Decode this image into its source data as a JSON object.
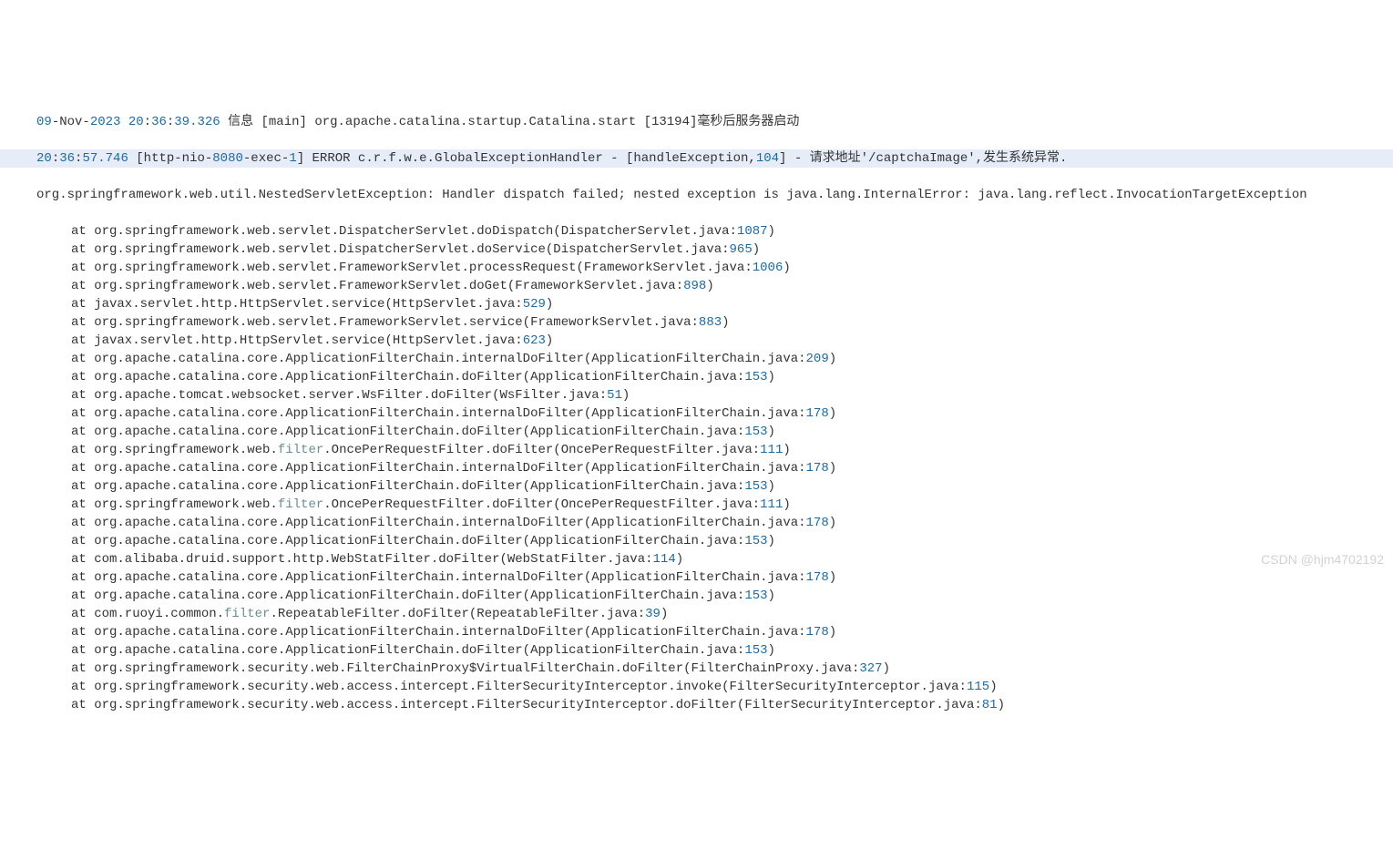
{
  "line1": {
    "day": "09",
    "dash1": "-Nov-",
    "year": "2023",
    "sp1": " ",
    "h": "20",
    "c1": ":",
    "m": "36",
    "c2": ":",
    "s": "39.326",
    "rest": " 信息 [main] org.apache.catalina.startup.Catalina.start [13194]毫秒后服务器启动"
  },
  "line2": {
    "h": "20",
    "c1": ":",
    "m": "36",
    "c2": ":",
    "s": "57.746",
    "thread1": " [http-nio-",
    "port": "8080",
    "thread2": "-exec-",
    "execno": "1",
    "thread3": "] ERROR c.r.f.w.e.GlobalExceptionHandler - [handleException,",
    "lineNo": "104",
    "thread4": "] - 请求地址'/captchaImage',发生系统异常."
  },
  "excMsg": "org.springframework.web.util.NestedServletException: Handler dispatch failed; nested exception is java.lang.InternalError: java.lang.reflect.InvocationTargetException",
  "stack": [
    {
      "pre": "at org.springframework.web.servlet.DispatcherServlet.doDispatch(DispatcherServlet.java:",
      "num": "1087",
      "post": ")"
    },
    {
      "pre": "at org.springframework.web.servlet.DispatcherServlet.doService(DispatcherServlet.java:",
      "num": "965",
      "post": ")"
    },
    {
      "pre": "at org.springframework.web.servlet.FrameworkServlet.processRequest(FrameworkServlet.java:",
      "num": "1006",
      "post": ")"
    },
    {
      "pre": "at org.springframework.web.servlet.FrameworkServlet.doGet(FrameworkServlet.java:",
      "num": "898",
      "post": ")"
    },
    {
      "pre": "at javax.servlet.http.HttpServlet.service(HttpServlet.java:",
      "num": "529",
      "post": ")"
    },
    {
      "pre": "at org.springframework.web.servlet.FrameworkServlet.service(FrameworkServlet.java:",
      "num": "883",
      "post": ")"
    },
    {
      "pre": "at javax.servlet.http.HttpServlet.service(HttpServlet.java:",
      "num": "623",
      "post": ")"
    },
    {
      "pre": "at org.apache.catalina.core.ApplicationFilterChain.internalDoFilter(ApplicationFilterChain.java:",
      "num": "209",
      "post": ")"
    },
    {
      "pre": "at org.apache.catalina.core.ApplicationFilterChain.doFilter(ApplicationFilterChain.java:",
      "num": "153",
      "post": ")"
    },
    {
      "pre": "at org.apache.tomcat.websocket.server.WsFilter.doFilter(WsFilter.java:",
      "num": "51",
      "post": ")"
    },
    {
      "pre": "at org.apache.catalina.core.ApplicationFilterChain.internalDoFilter(ApplicationFilterChain.java:",
      "num": "178",
      "post": ")"
    },
    {
      "pre": "at org.apache.catalina.core.ApplicationFilterChain.doFilter(ApplicationFilterChain.java:",
      "num": "153",
      "post": ")"
    },
    {
      "pre": "at org.springframework.web.",
      "kw": "filter",
      "mid": ".OncePerRequestFilter.doFilter(OncePerRequestFilter.java:",
      "num": "111",
      "post": ")"
    },
    {
      "pre": "at org.apache.catalina.core.ApplicationFilterChain.internalDoFilter(ApplicationFilterChain.java:",
      "num": "178",
      "post": ")"
    },
    {
      "pre": "at org.apache.catalina.core.ApplicationFilterChain.doFilter(ApplicationFilterChain.java:",
      "num": "153",
      "post": ")"
    },
    {
      "pre": "at org.springframework.web.",
      "kw": "filter",
      "mid": ".OncePerRequestFilter.doFilter(OncePerRequestFilter.java:",
      "num": "111",
      "post": ")"
    },
    {
      "pre": "at org.apache.catalina.core.ApplicationFilterChain.internalDoFilter(ApplicationFilterChain.java:",
      "num": "178",
      "post": ")"
    },
    {
      "pre": "at org.apache.catalina.core.ApplicationFilterChain.doFilter(ApplicationFilterChain.java:",
      "num": "153",
      "post": ")"
    },
    {
      "pre": "at com.alibaba.druid.support.http.WebStatFilter.doFilter(WebStatFilter.java:",
      "num": "114",
      "post": ")"
    },
    {
      "pre": "at org.apache.catalina.core.ApplicationFilterChain.internalDoFilter(ApplicationFilterChain.java:",
      "num": "178",
      "post": ")"
    },
    {
      "pre": "at org.apache.catalina.core.ApplicationFilterChain.doFilter(ApplicationFilterChain.java:",
      "num": "153",
      "post": ")"
    },
    {
      "pre": "at com.ruoyi.common.",
      "kw": "filter",
      "mid": ".RepeatableFilter.doFilter(RepeatableFilter.java:",
      "num": "39",
      "post": ")"
    },
    {
      "pre": "at org.apache.catalina.core.ApplicationFilterChain.internalDoFilter(ApplicationFilterChain.java:",
      "num": "178",
      "post": ")"
    },
    {
      "pre": "at org.apache.catalina.core.ApplicationFilterChain.doFilter(ApplicationFilterChain.java:",
      "num": "153",
      "post": ")"
    },
    {
      "pre": "at org.springframework.security.web.FilterChainProxy$VirtualFilterChain.doFilter(FilterChainProxy.java:",
      "num": "327",
      "post": ")"
    },
    {
      "pre": "at org.springframework.security.web.access.intercept.FilterSecurityInterceptor.invoke(FilterSecurityInterceptor.java:",
      "num": "115",
      "post": ")"
    },
    {
      "pre": "at org.springframework.security.web.access.intercept.FilterSecurityInterceptor.doFilter(FilterSecurityInterceptor.java:",
      "num": "81",
      "post": ")"
    }
  ],
  "watermark": "CSDN @hjm4702192"
}
